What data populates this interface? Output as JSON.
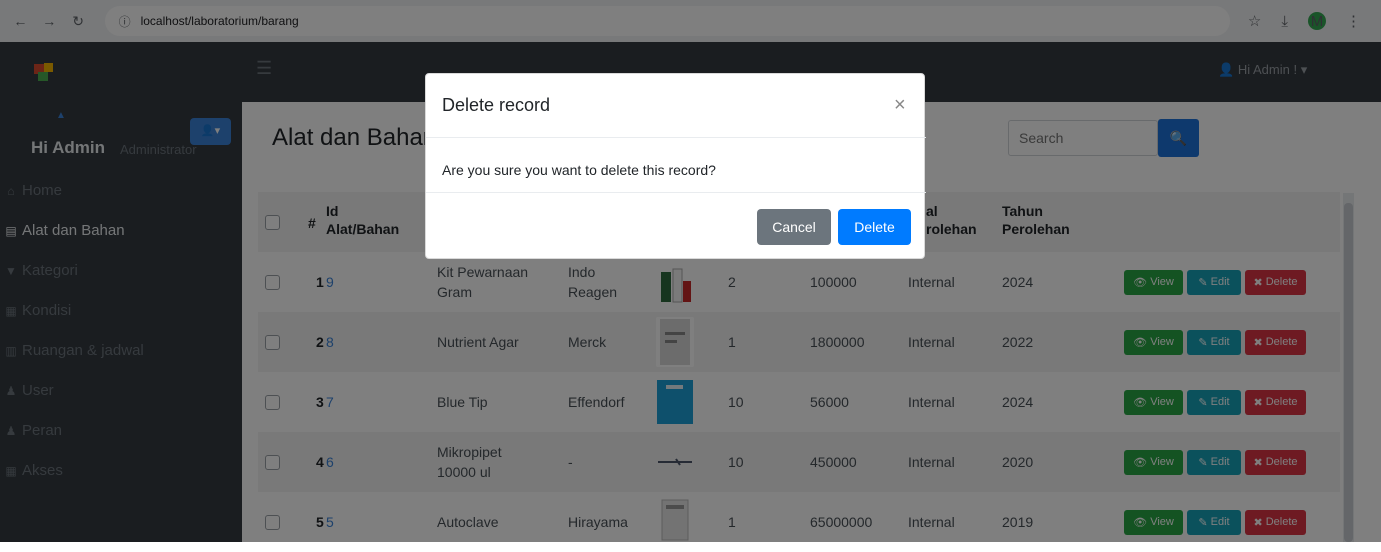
{
  "browser": {
    "url": "localhost/laboratorium/barang",
    "profile_initial": "M"
  },
  "app": {
    "admin_menu_label": "Hi Admin !",
    "sidebar": {
      "user_name": "Hi Admin",
      "role": "Administrator",
      "items": [
        {
          "label": "Home",
          "icon": "home-icon",
          "active": false
        },
        {
          "label": "Alat dan Bahan",
          "icon": "database-icon",
          "active": true
        },
        {
          "label": "Kategori",
          "icon": "filter-icon",
          "active": false
        },
        {
          "label": "Kondisi",
          "icon": "list-icon",
          "active": false
        },
        {
          "label": "Ruangan & jadwal",
          "icon": "book-icon",
          "active": false
        },
        {
          "label": "User",
          "icon": "user-icon",
          "active": false
        },
        {
          "label": "Peran",
          "icon": "user-plus-icon",
          "active": false
        },
        {
          "label": "Akses",
          "icon": "table-icon",
          "active": false
        }
      ]
    },
    "main": {
      "title": "Alat dan Bahan",
      "search_placeholder": "Search",
      "headers": {
        "hash": "#",
        "id": "Id\nAlat/Bahan",
        "asal": "al\nrolehan",
        "tahun": "Tahun\nPerolehan"
      },
      "rows": [
        {
          "no": "1",
          "id": "9",
          "name": "Kit Pewarnaan Gram",
          "merk": "Indo Reagen",
          "qty": "2",
          "price": "100000",
          "asal": "Internal",
          "year": "2024"
        },
        {
          "no": "2",
          "id": "8",
          "name": "Nutrient Agar",
          "merk": "Merck",
          "qty": "1",
          "price": "1800000",
          "asal": "Internal",
          "year": "2022"
        },
        {
          "no": "3",
          "id": "7",
          "name": "Blue Tip",
          "merk": "Effendorf",
          "qty": "10",
          "price": "56000",
          "asal": "Internal",
          "year": "2024"
        },
        {
          "no": "4",
          "id": "6",
          "name": "Mikropipet 10000 ul",
          "merk": "-",
          "qty": "10",
          "price": "450000",
          "asal": "Internal",
          "year": "2020"
        },
        {
          "no": "5",
          "id": "5",
          "name": "Autoclave",
          "merk": "Hirayama",
          "qty": "1",
          "price": "65000000",
          "asal": "Internal",
          "year": "2019"
        }
      ],
      "buttons": {
        "view": "View",
        "edit": "Edit",
        "delete": "Delete"
      }
    }
  },
  "modal": {
    "title": "Delete record",
    "body": "Are you sure you want to delete this record?",
    "cancel_label": "Cancel",
    "delete_label": "Delete"
  }
}
